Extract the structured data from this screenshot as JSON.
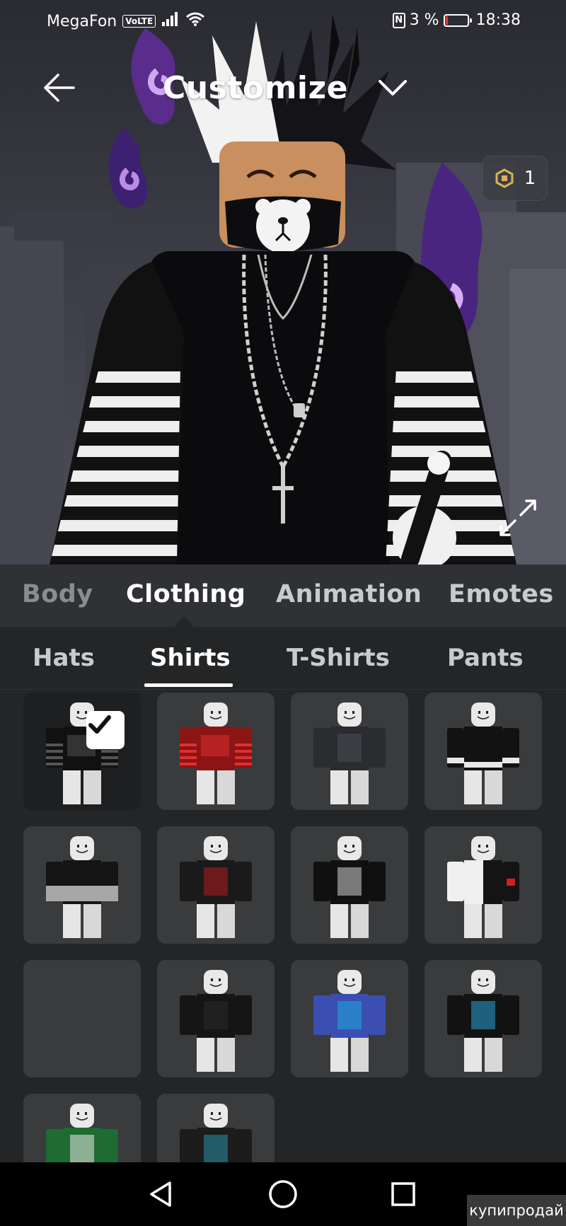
{
  "status_bar": {
    "carrier": "MegaFon",
    "volte": "VoLTE",
    "nfc": "N",
    "battery": "3 %",
    "time": "18:38"
  },
  "header": {
    "title": "Customize",
    "robux_count": "1"
  },
  "category_tabs": [
    "Body",
    "Clothing",
    "Animation",
    "Emotes"
  ],
  "active_category": "Clothing",
  "subcategory_tabs": [
    "Hats",
    "Shirts",
    "T-Shirts",
    "Pants"
  ],
  "active_subcategory": "Shirts",
  "items": [
    {
      "name": "shirt-black-striped",
      "selected": true,
      "shirt": "#111111",
      "accent": "#555555",
      "sleeve": "stripes"
    },
    {
      "name": "shirt-red-flames",
      "selected": false,
      "shirt": "#8c1414",
      "accent": "#e03030",
      "sleeve": "stripes"
    },
    {
      "name": "shirt-dark-camo",
      "selected": false,
      "shirt": "#2a2c30",
      "accent": "#4a4d52",
      "sleeve": "solid"
    },
    {
      "name": "shirt-black-white-cuffs",
      "selected": false,
      "shirt": "#121212",
      "accent": "#e8e8e8",
      "sleeve": "cuffs"
    },
    {
      "name": "shirt-black-fade",
      "selected": false,
      "shirt": "#141414",
      "accent": "#d8d8d8",
      "sleeve": "fade"
    },
    {
      "name": "shirt-red-camo",
      "selected": false,
      "shirt": "#1a1a1a",
      "accent": "#b01c1c",
      "sleeve": "solid"
    },
    {
      "name": "shirt-black-graphic",
      "selected": false,
      "shirt": "#101010",
      "accent": "#cfcfcf",
      "sleeve": "solid"
    },
    {
      "name": "shirt-white-black-split",
      "selected": false,
      "shirt": "#f0f0f0",
      "accent": "#141414",
      "sleeve": "split"
    },
    {
      "name": "shirt-loading",
      "selected": false,
      "shirt": "",
      "accent": "",
      "sleeve": "none"
    },
    {
      "name": "shirt-black-plain",
      "selected": false,
      "shirt": "#151515",
      "accent": "#2a2a2a",
      "sleeve": "solid"
    },
    {
      "name": "shirt-blue-plaid",
      "selected": false,
      "shirt": "#3a4fb0",
      "accent": "#1fa7d8",
      "sleeve": "solid"
    },
    {
      "name": "shirt-black-blue-tee",
      "selected": false,
      "shirt": "#121212",
      "accent": "#2aa1d6",
      "sleeve": "solid"
    },
    {
      "name": "shirt-green-jersey",
      "selected": false,
      "shirt": "#1f6b34",
      "accent": "#e8e8e8",
      "sleeve": "solid"
    },
    {
      "name": "shirt-black-jacket",
      "selected": false,
      "shirt": "#1c1c1c",
      "accent": "#2a8fa8",
      "sleeve": "solid"
    }
  ],
  "watermark": "купипродай",
  "colors": {
    "background": "#232527",
    "tab_bar": "#2f3134",
    "card": "#393b3d",
    "card_selected": "#1e1f21",
    "text_primary": "#ffffff",
    "text_secondary": "#c8cacc"
  },
  "icons": {
    "back": "arrow-left-icon",
    "title_dropdown": "chevron-down-icon",
    "robux": "robux-icon",
    "expand": "expand-arrows-icon",
    "selected": "checkmark-icon",
    "nav_back": "triangle-back-icon",
    "nav_home": "circle-home-icon",
    "nav_recents": "square-recents-icon"
  }
}
